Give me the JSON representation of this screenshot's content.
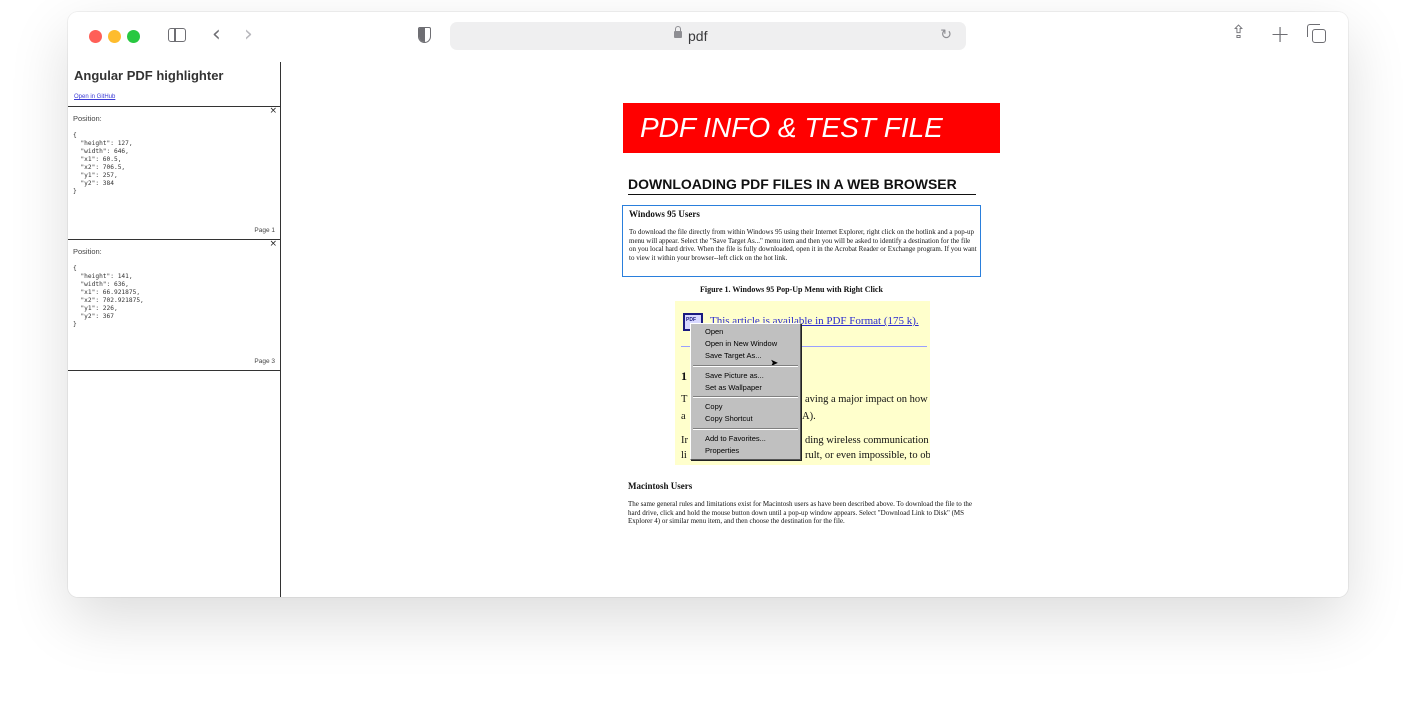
{
  "browser": {
    "url": "pdf"
  },
  "sidebar": {
    "title": "Angular PDF highlighter",
    "github_link": "Open in GitHub",
    "highlights": [
      {
        "label": "Position:",
        "json": "{\n  \"height\": 127,\n  \"width\": 646,\n  \"x1\": 60.5,\n  \"x2\": 706.5,\n  \"y1\": 257,\n  \"y2\": 384\n}",
        "page": "Page 1"
      },
      {
        "label": "Position:",
        "json": "{\n  \"height\": 141,\n  \"width\": 636,\n  \"x1\": 66.921875,\n  \"x2\": 702.921875,\n  \"y1\": 226,\n  \"y2\": 367\n}",
        "page": "Page 3"
      }
    ],
    "close_glyph": "×"
  },
  "pdf": {
    "banner": "PDF INFO & TEST FILE",
    "heading": "DOWNLOADING PDF FILES IN A WEB BROWSER",
    "win_heading": "Windows 95 Users",
    "win_text": "To download the file directly from within Windows 95 using their Internet Explorer, right click on the hotlink and a pop-up menu will appear. Select the \"Save Target As...\" menu item and then you will be asked to identify a destination for the file on you local hard drive. When the file is fully downloaded, open it in the Acrobat Reader or Exchange program. If you want to view it within your browser--left click on the hot link.",
    "figure_caption": "Figure 1. Windows 95 Pop-Up Menu with Right Click",
    "figure": {
      "link": "This article is available in PDF Format (175 k).",
      "number": "1",
      "line1_start": "T",
      "line1_end": "aving a major impact on how",
      "line2_start": "a",
      "line2_end": "A).",
      "line3_start": "Ir",
      "line3_end": "ding wireless communication s",
      "line4_start": "li",
      "line4_end": "rult, or even impossible, to ob",
      "menu": {
        "open": "Open",
        "open_new_window": "Open in New Window",
        "save_target": "Save Target As...",
        "save_picture": "Save Picture as...",
        "set_wallpaper": "Set as Wallpaper",
        "copy": "Copy",
        "copy_shortcut": "Copy Shortcut",
        "add_favorites": "Add to Favorites...",
        "properties": "Properties"
      }
    },
    "mac_heading": "Macintosh Users",
    "mac_text": "The same general rules and limitations exist for Macintosh users as have been described above. To download the file to the hard drive, click and hold the mouse button down until a pop-up window appears. Select \"Download Link to Disk\" (MS Explorer 4) or similar menu item, and then choose the destination for the file."
  }
}
